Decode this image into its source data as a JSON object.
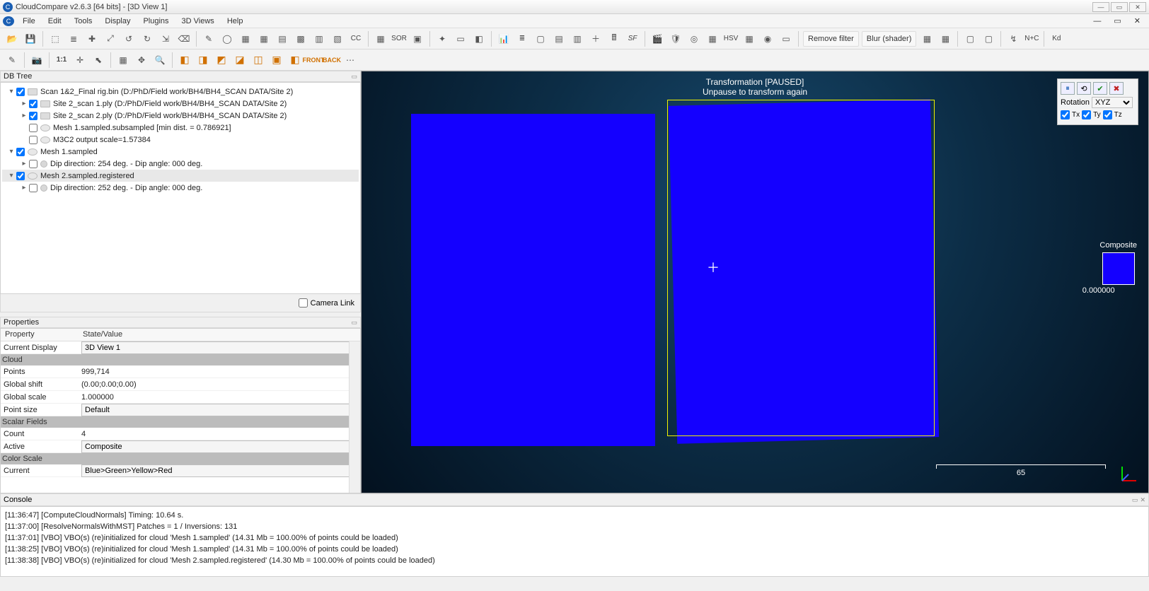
{
  "title": "CloudCompare v2.6.3 [64 bits] - [3D View 1]",
  "menu": {
    "file": "File",
    "edit": "Edit",
    "tools": "Tools",
    "display": "Display",
    "plugins": "Plugins",
    "views": "3D Views",
    "help": "Help"
  },
  "toolbar": {
    "removeFilter": "Remove filter",
    "blur": "Blur (shader)",
    "sor": "SOR",
    "sf": "SF",
    "xyz": "XYZ",
    "hsv": "HSV",
    "nc": "N+C",
    "kd": "Kd",
    "ratio": "1:1",
    "front": "FRONT",
    "back": "BACK"
  },
  "dbtree": {
    "title": "DB Tree",
    "cameraLink": "Camera Link",
    "items": [
      {
        "depth": 0,
        "tw": "▾",
        "chk": true,
        "icon": "folder",
        "label": "Scan 1&2_Final rig.bin (D:/PhD/Field work/BH4/BH4_SCAN DATA/Site 2)"
      },
      {
        "depth": 1,
        "tw": "▸",
        "chk": true,
        "icon": "folder",
        "label": "Site 2_scan 1.ply (D:/PhD/Field work/BH4/BH4_SCAN DATA/Site 2)"
      },
      {
        "depth": 1,
        "tw": "▸",
        "chk": true,
        "icon": "folder",
        "label": "Site 2_scan 2.ply (D:/PhD/Field work/BH4/BH4_SCAN DATA/Site 2)"
      },
      {
        "depth": 1,
        "tw": "",
        "chk": false,
        "icon": "cloud",
        "label": "Mesh 1.sampled.subsampled [min dist. = 0.786921]"
      },
      {
        "depth": 1,
        "tw": "",
        "chk": false,
        "icon": "cloud",
        "label": "M3C2 output scale=1.57384"
      },
      {
        "depth": 0,
        "tw": "▾",
        "chk": true,
        "icon": "cloud",
        "label": "Mesh 1.sampled"
      },
      {
        "depth": 1,
        "tw": "▸",
        "chk": false,
        "icon": "dip",
        "label": "Dip direction: 254 deg. - Dip angle: 000 deg."
      },
      {
        "depth": 0,
        "tw": "▾",
        "chk": true,
        "icon": "cloud",
        "label": "Mesh 2.sampled.registered",
        "selected": true
      },
      {
        "depth": 1,
        "tw": "▸",
        "chk": false,
        "icon": "dip",
        "label": "Dip direction: 252 deg. - Dip angle: 000 deg."
      }
    ]
  },
  "properties": {
    "title": "Properties",
    "head": {
      "c1": "Property",
      "c2": "State/Value"
    },
    "rows": [
      {
        "type": "select",
        "k": "Current Display",
        "v": "3D View 1"
      },
      {
        "type": "sec",
        "k": "Cloud"
      },
      {
        "type": "row",
        "k": "Points",
        "v": "999,714"
      },
      {
        "type": "row",
        "k": "Global shift",
        "v": "(0.00;0.00;0.00)"
      },
      {
        "type": "row",
        "k": "Global scale",
        "v": "1.000000"
      },
      {
        "type": "select",
        "k": "Point size",
        "v": "Default"
      },
      {
        "type": "sec",
        "k": "Scalar Fields"
      },
      {
        "type": "row",
        "k": "Count",
        "v": "4"
      },
      {
        "type": "select",
        "k": "Active",
        "v": "Composite"
      },
      {
        "type": "sec",
        "k": "Color Scale"
      },
      {
        "type": "select",
        "k": "Current",
        "v": "Blue>Green>Yellow>Red"
      }
    ]
  },
  "view3d": {
    "line1": "Transformation [PAUSED]",
    "line2": "Unpause to transform again",
    "composite": "Composite",
    "compositeVal": "0.000000",
    "scale": "65"
  },
  "floatpanel": {
    "rotation": "Rotation",
    "rotmode": "XYZ",
    "tx": "Tx",
    "ty": "Ty",
    "tz": "Tz"
  },
  "console": {
    "title": "Console",
    "lines": [
      "[11:36:47] [ComputeCloudNormals] Timing: 10.64 s.",
      "[11:37:00] [ResolveNormalsWithMST] Patches = 1 / Inversions: 131",
      "[11:37:01] [VBO] VBO(s) (re)initialized for cloud 'Mesh 1.sampled' (14.31 Mb = 100.00% of points could be loaded)",
      "[11:38:25] [VBO] VBO(s) (re)initialized for cloud 'Mesh 1.sampled' (14.31 Mb = 100.00% of points could be loaded)",
      "[11:38:38] [VBO] VBO(s) (re)initialized for cloud 'Mesh 2.sampled.registered' (14.30 Mb = 100.00% of points could be loaded)"
    ]
  }
}
